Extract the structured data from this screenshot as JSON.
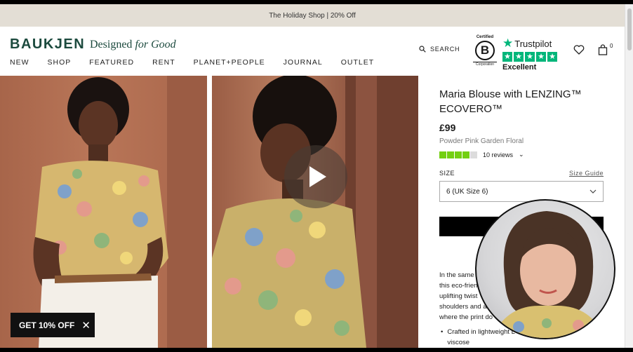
{
  "promo": {
    "text": "The Holiday Shop | 20% Off"
  },
  "brand": {
    "logo": "BAUKJEN",
    "tagline_prefix": "Designed",
    "tagline_italic": "for Good"
  },
  "nav": {
    "items": [
      "NEW",
      "SHOP",
      "FEATURED",
      "RENT",
      "PLANET+PEOPLE",
      "JOURNAL",
      "OUTLET"
    ]
  },
  "header": {
    "search_label": "SEARCH",
    "bcorp": {
      "certified": "Certified",
      "letter": "B",
      "corporation": "Corporation"
    },
    "trustpilot": {
      "name": "Trustpilot",
      "rating_word": "Excellent",
      "stars": 5
    },
    "cart_count": "0"
  },
  "product": {
    "title": "Maria Blouse with LENZING™ ECOVERO™",
    "price": "£99",
    "color": "Powder Pink Garden Floral",
    "rating_stars": 4,
    "reviews": "10 reviews",
    "size_label": "SIZE",
    "size_guide": "Size Guide",
    "size_selected": "6 (UK Size 6)",
    "description_lines": [
      "In the same",
      "this eco-frien",
      "uplifting twist",
      "shoulders and a",
      "where the print do"
    ],
    "bullets": [
      "Crafted in lightweight L",
      "viscose"
    ]
  },
  "offer": {
    "label": "GET 10% OFF"
  },
  "colors": {
    "promo_bg": "#e3ded5",
    "brand_green": "#1c4a3e",
    "trustpilot_green": "#00b67a",
    "review_green": "#73cf11"
  },
  "icons": [
    "search-icon",
    "heart-icon",
    "bag-icon",
    "play-icon",
    "close-icon",
    "chevron-down-icon"
  ]
}
